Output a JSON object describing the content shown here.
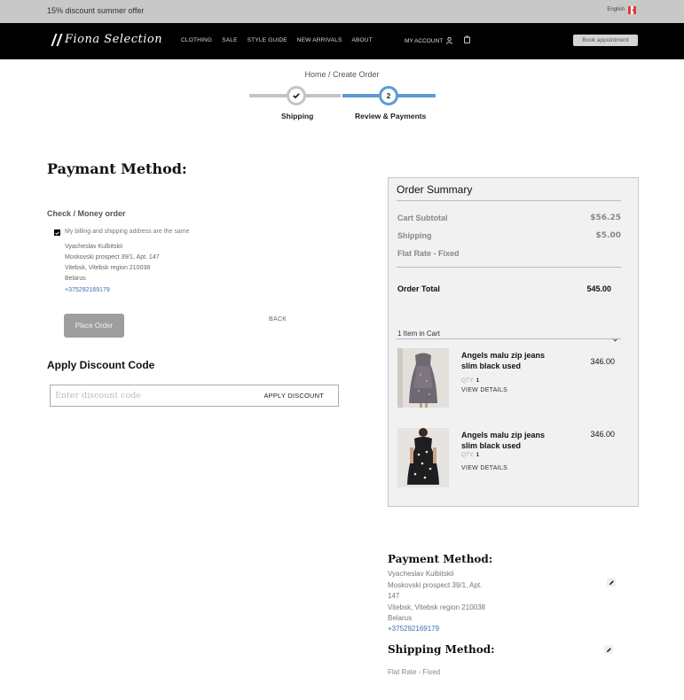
{
  "promo": {
    "text": "15% discount summer offer",
    "language": "English"
  },
  "header": {
    "logo": "Fiona Selection",
    "nav": [
      "CLOTHING",
      "SALE",
      "STYLE GUIDE",
      "NEW ARRIVALS",
      "ABOUT"
    ],
    "account": "MY ACCOUNT",
    "book": "Book appointment"
  },
  "breadcrumb": "Home / Create Order",
  "steps": {
    "step1": "Shipping",
    "step2_number": "2",
    "step2": "Review & Payments"
  },
  "payment": {
    "title": "Paymant Method:",
    "method": "Check / Money order",
    "billing_same": "My billing and shipping address are the same",
    "address": [
      "Vyacheslav Kulbitskii",
      "Moskovski prospect 39/1, Apt. 147",
      "Vitebsk, Vitebsk region 210038",
      "Belarus"
    ],
    "phone": "+375292169179",
    "place_order": "Place Order",
    "back": "BACK"
  },
  "discount": {
    "title": "Apply Discount Code",
    "placeholder": "Enter discount code",
    "apply": "APPLY DISCOUNT"
  },
  "summary": {
    "title": "Order Summary",
    "subtotal_label": "Cart Subtotal",
    "subtotal": "$56.25",
    "shipping_label": "Shipping",
    "shipping": "$5.00",
    "flat_rate": "Flat Rate - Fixed",
    "total_label": "Order Total",
    "total": "545.00",
    "items_in_cart": "1 Item in Cart",
    "items": [
      {
        "name": "Angels malu zip jeans slim black used",
        "price": "346.00",
        "qty_label": "QTY:",
        "qty": "1",
        "details": "VIEW DETAILS"
      },
      {
        "name": "Angels malu zip jeans slim black used",
        "price": "346.00",
        "qty_label": "QTY:",
        "qty": "1",
        "details": "VIEW DETAILS"
      }
    ]
  },
  "review": {
    "payment_title": "Payment Method:",
    "address": [
      "Vyacheslav Kulbitskii",
      "Moskovski prospect 39/1, Apt.",
      "147",
      "Vitebsk, Vitebsk region 210038",
      "Belarus"
    ],
    "phone": "+375292169179",
    "shipping_title": "Shipping Method:",
    "shipping_method": "Flat Rate - Fixed"
  },
  "colors": {
    "accent": "#5b9bd5",
    "link": "#3a6fb0",
    "header_bg": "#000000",
    "promo_bg": "#c8c8c8"
  }
}
